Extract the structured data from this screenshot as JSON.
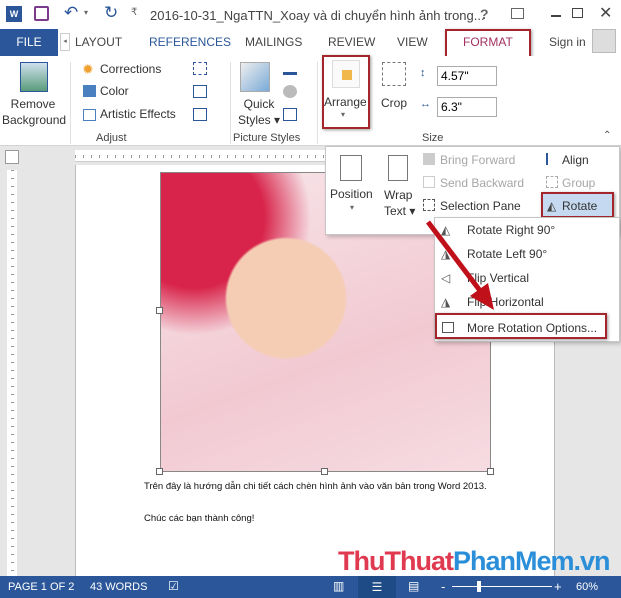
{
  "title_bar": {
    "doc_title": "2016-10-31_NgaTTN_Xoay và di chuyển hình ảnh trong...",
    "help": "?"
  },
  "tabs": {
    "file": "FILE",
    "items": [
      "LAYOUT",
      "REFERENCES",
      "MAILINGS",
      "REVIEW",
      "VIEW",
      "FORMAT"
    ],
    "sign_in": "Sign in"
  },
  "ribbon": {
    "remove_bg": [
      "Remove",
      "Background"
    ],
    "corrections": "Corrections",
    "color": "Color",
    "artistic": "Artistic Effects",
    "adjust": "Adjust",
    "quick_styles": [
      "Quick",
      "Styles"
    ],
    "picture_styles": "Picture Styles",
    "arrange": "Arrange",
    "crop": "Crop",
    "height": "4.57\"",
    "width": "6.3\"",
    "size": "Size"
  },
  "arrange_menu": {
    "position": "Position",
    "wrap": [
      "Wrap",
      "Text"
    ],
    "bring_forward": "Bring Forward",
    "send_backward": "Send Backward",
    "selection_pane": "Selection Pane",
    "align": "Align",
    "group": "Group",
    "rotate": "Rotate"
  },
  "rotate_menu": [
    "Rotate Right 90°",
    "Rotate Left 90°",
    "Flip Vertical",
    "Flip Horizontal",
    "More Rotation Options..."
  ],
  "document": {
    "para1": "Trên đây là hướng dẫn chi tiết cách chèn hình ảnh vào văn bản trong Word 2013.",
    "para2": "Chúc các bạn thành công!"
  },
  "watermark": {
    "part1": "ThuThuat",
    "part2": "PhanMem",
    "part3": ".vn"
  },
  "status": {
    "page": "PAGE 1 OF 2",
    "words": "43 WORDS",
    "zoom": "60%",
    "zoom_level_percent": 60
  },
  "colors": {
    "accent": "#2b579a",
    "format_tab": "#a2305e",
    "highlight": "#a4262c"
  }
}
